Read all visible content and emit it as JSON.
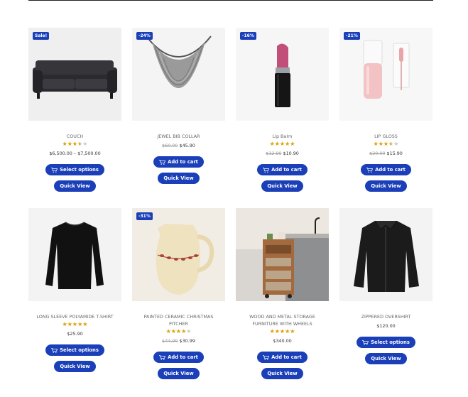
{
  "colors": {
    "accent": "#1a3fb8",
    "star": "#e0a100",
    "star_empty": "#c8c8c8"
  },
  "labels": {
    "quick_view": "Quick View",
    "select_options": "Select options",
    "add_to_cart": "Add to cart"
  },
  "products": [
    {
      "title": "COUCH",
      "badge": "Sale!",
      "rating": 3.5,
      "price_old": "",
      "price": "$6,500.00 – $7,500.00",
      "action": "Select options",
      "quick_view": "Quick View"
    },
    {
      "title": "JEWEL BIB COLLAR",
      "badge": "-24%",
      "rating": null,
      "price_old": "$60.00",
      "price": "$45.90",
      "action": "Add to cart",
      "quick_view": "Quick View"
    },
    {
      "title": "Lip Balm",
      "badge": "-16%",
      "rating": 5,
      "price_old": "$12.90",
      "price": "$10.90",
      "action": "Add to cart",
      "quick_view": "Quick View"
    },
    {
      "title": "LIP GLOSS",
      "badge": "-21%",
      "rating": 3.5,
      "price_old": "$20.00",
      "price": "$15.90",
      "action": "Add to cart",
      "quick_view": "Quick View"
    },
    {
      "title": "LONG SLEEVE POLYAMIDE T-SHIRT",
      "badge": "",
      "rating": 5,
      "price_old": "",
      "price": "$25.90",
      "action": "Select options",
      "quick_view": "Quick View"
    },
    {
      "title": "PAINTED CERAMIC CHRISTMAS PITCHER",
      "badge": "-31%",
      "rating": 4,
      "price_old": "$44.99",
      "price": "$30.99",
      "action": "Add to cart",
      "quick_view": "Quick View"
    },
    {
      "title": "WOOD AND METAL STORAGE FURNITURE WITH WHEELS",
      "badge": "",
      "rating": 5,
      "price_old": "",
      "price": "$340.00",
      "action": "Add to cart",
      "quick_view": "Quick View"
    },
    {
      "title": "ZIPPERED OVERSHIRT",
      "badge": "",
      "rating": null,
      "price_old": "",
      "price": "$120.00",
      "action": "Select options",
      "quick_view": "Quick View"
    }
  ]
}
